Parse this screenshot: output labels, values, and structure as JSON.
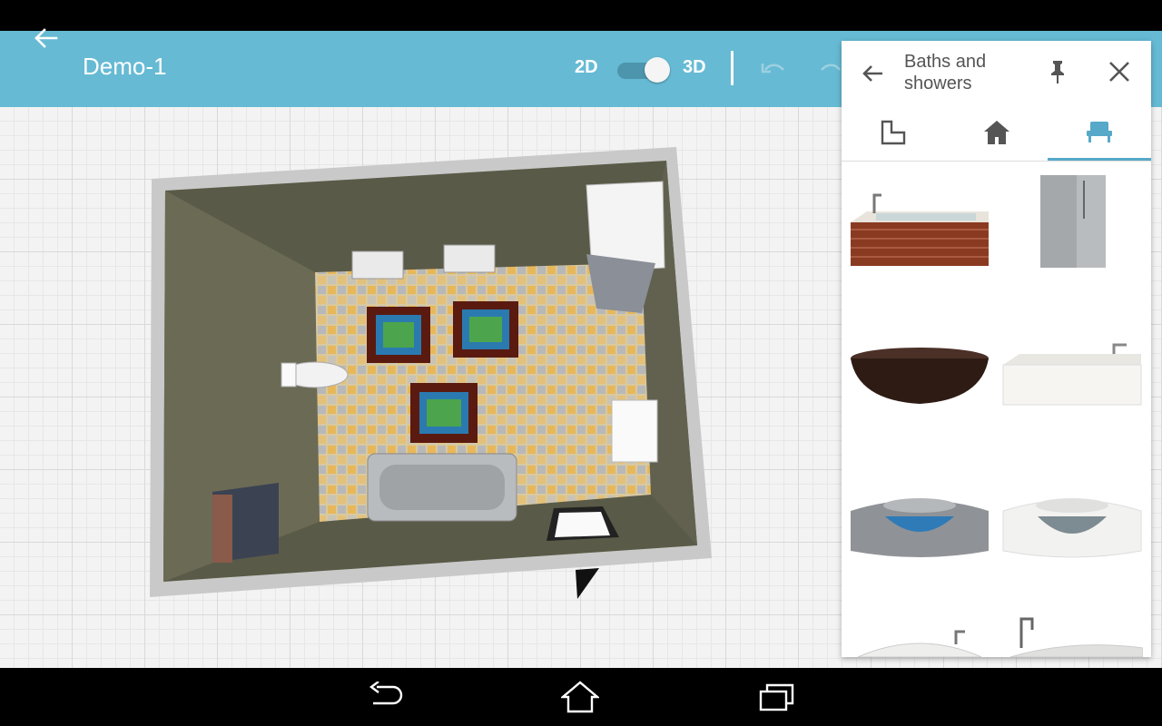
{
  "app": {
    "title": "Demo-1",
    "mode_2d": "2D",
    "mode_3d": "3D",
    "mode_selected": "3D"
  },
  "panel": {
    "title": "Baths and showers",
    "tabs": [
      {
        "icon": "floorplan-icon",
        "selected": false
      },
      {
        "icon": "home-icon",
        "selected": false
      },
      {
        "icon": "furniture-icon",
        "selected": true
      }
    ],
    "items": [
      {
        "icon": "tiled-bathtub-icon"
      },
      {
        "icon": "shower-cabin-icon"
      },
      {
        "icon": "freestanding-dark-bathtub-icon"
      },
      {
        "icon": "white-bathtub-icon"
      },
      {
        "icon": "corner-jacuzzi-grey-icon"
      },
      {
        "icon": "corner-jacuzzi-white-icon"
      },
      {
        "icon": "whirlpool-bathtub-icon"
      },
      {
        "icon": "round-bathtub-faucet-icon"
      }
    ]
  },
  "colors": {
    "appbar": "#66bad4",
    "accent": "#56a9c8",
    "toggle_track": "#4d95ad"
  }
}
